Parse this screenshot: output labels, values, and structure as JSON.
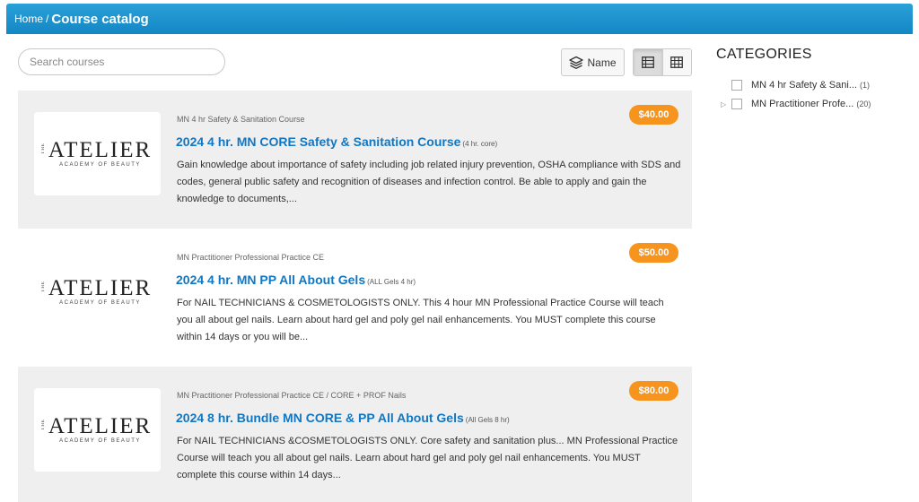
{
  "breadcrumb": {
    "home": "Home",
    "separator": "/",
    "current": "Course catalog"
  },
  "search": {
    "placeholder": "Search courses",
    "value": ""
  },
  "toolbar": {
    "sort_label": "Name",
    "list_view": "list-view-icon",
    "grid_view": "grid-view-icon"
  },
  "courses": [
    {
      "logo": {
        "main": "ATELIER",
        "the": "THE",
        "sub": "ACADEMY OF BEAUTY"
      },
      "category": "MN 4 hr Safety & Sanitation Course",
      "title": "2024 4 hr. MN CORE Safety & Sanitation Course",
      "tag": "(4 hr. core)",
      "description": "Gain knowledge about importance of safety including job related injury prevention, OSHA compliance with SDS and codes, general public safety and recognition of diseases and infection control. Be able to apply and gain the knowledge to documents,...",
      "price": "$40.00"
    },
    {
      "logo": {
        "main": "ATELIER",
        "the": "THE",
        "sub": "ACADEMY OF BEAUTY"
      },
      "category": "MN Practitioner Professional Practice CE",
      "title": "2024 4 hr. MN PP All About Gels",
      "tag": "(ALL Gels 4 hr)",
      "description": "For NAIL TECHNICIANS & COSMETOLOGISTS ONLY. This 4 hour MN Professional Practice Course will teach you all about gel nails. Learn about hard gel and poly gel nail enhancements. You MUST complete this course within 14 days or you will be...",
      "price": "$50.00"
    },
    {
      "logo": {
        "main": "ATELIER",
        "the": "THE",
        "sub": "ACADEMY OF BEAUTY"
      },
      "category": "MN Practitioner Professional Practice CE / CORE + PROF Nails",
      "title": "2024 8 hr. Bundle MN CORE & PP All About Gels",
      "tag": "(All Gels 8 hr)",
      "description": "For NAIL TECHNICIANS &COSMETOLOGISTS ONLY. Core safety and sanitation plus... MN Professional Practice Course will teach you all about gel nails. Learn about hard gel and poly gel nail enhancements. You MUST complete this course within 14 days...",
      "price": "$80.00"
    }
  ],
  "categories": {
    "heading": "CATEGORIES",
    "items": [
      {
        "label": "MN 4 hr Safety & Sani...",
        "count": "(1)",
        "expandable": false
      },
      {
        "label": "MN Practitioner Profe...",
        "count": "(20)",
        "expandable": true
      }
    ]
  },
  "colors": {
    "header": "#1a8fcc",
    "price_badge": "#f7941d",
    "title_link": "#1177c2",
    "shaded_row": "#efefef"
  }
}
